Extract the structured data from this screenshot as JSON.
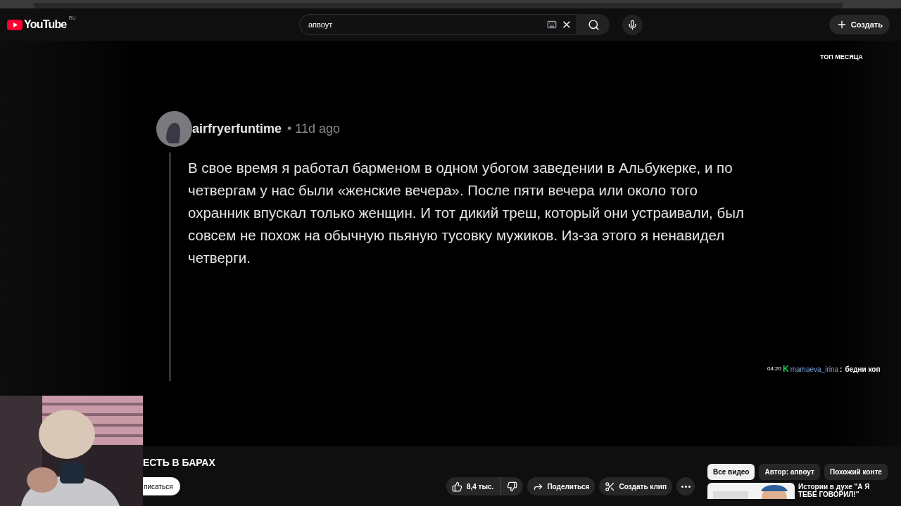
{
  "logo": {
    "text": "YouTube",
    "region": "RU"
  },
  "search": {
    "value": "апвоут"
  },
  "create_button": "Создать",
  "video": {
    "badge": "ТОП МЕСЯЦА",
    "comment": {
      "author": "airfryerfuntime",
      "age": "• 11d ago",
      "text": "В свое время я работал барменом в одном убогом заведении в Альбукерке, и по четвергам у нас были «женские вечера». После пяти вечера или около того охранник впускал только женщин. И тот дикий треш, который они устраивали, был совсем не похож на обычную пьяную тусовку мужиков. Из-за этого я ненавидел четверги."
    },
    "chat": {
      "time": "04:20",
      "badge": "K",
      "user": "mamaeva_irina",
      "separator": ":",
      "message": "бедни коп"
    }
  },
  "title": "ЕСТЬ В БАРАХ",
  "subscribe_button": "писаться",
  "actions": {
    "likes": "8,4 тыс.",
    "share": "Поделиться",
    "clip": "Создать клип"
  },
  "chips": [
    {
      "label": "Все видео",
      "selected": true
    },
    {
      "label": "Автор: апвоут",
      "selected": false
    },
    {
      "label": "Похожий конте",
      "selected": false
    }
  ],
  "recommendations": [
    {
      "title": "Истории в духе \"А Я ТЕБЕ ГОВОРИЛ!\""
    }
  ]
}
